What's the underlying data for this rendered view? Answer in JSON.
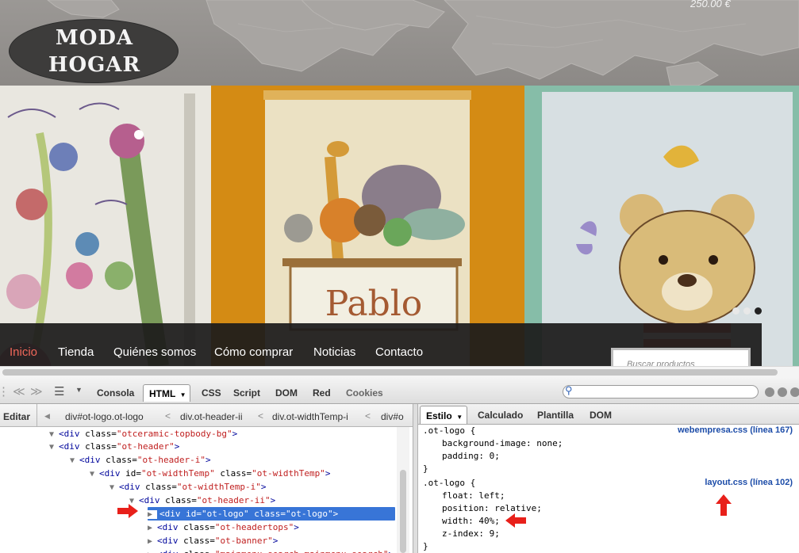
{
  "site": {
    "price": "250.00 €",
    "logo": {
      "line1": "MODA",
      "line2": "HOGAR"
    },
    "slider": {
      "panel2_name": "Pablo",
      "dots": 3,
      "active_dot": 3
    },
    "nav": {
      "items": [
        "Inicio",
        "Tienda",
        "Quiénes somos",
        "Cómo comprar",
        "Noticias",
        "Contacto"
      ],
      "active_index": 0
    },
    "search": {
      "placeholder": "Buscar productos"
    }
  },
  "firebug": {
    "toolbar": {
      "tabs": [
        "Consola",
        "HTML",
        "CSS",
        "Script",
        "DOM",
        "Red",
        "Cookies"
      ],
      "active_tab": "HTML",
      "search_value": ""
    },
    "breadcrumb": {
      "edit_label": "Editar",
      "items": [
        "div#ot-logo.ot-logo",
        "div.ot-header-ii",
        "div.ot-widthTemp-i",
        "div#o"
      ]
    },
    "tree": [
      {
        "tag": "div",
        "attrs": [
          [
            "class",
            "otceramic-topbody-bg"
          ]
        ],
        "twisty": "open"
      },
      {
        "tag": "div",
        "attrs": [
          [
            "class",
            "ot-header"
          ]
        ],
        "twisty": "open"
      },
      {
        "tag": "div",
        "attrs": [
          [
            "class",
            "ot-header-i"
          ]
        ],
        "twisty": "open"
      },
      {
        "tag": "div",
        "attrs": [
          [
            "id",
            "ot-widthTemp"
          ],
          [
            "class",
            "ot-widthTemp"
          ]
        ],
        "twisty": "open"
      },
      {
        "tag": "div",
        "attrs": [
          [
            "class",
            "ot-widthTemp-i"
          ]
        ],
        "twisty": "open"
      },
      {
        "tag": "div",
        "attrs": [
          [
            "class",
            "ot-header-ii"
          ]
        ],
        "twisty": "open"
      },
      {
        "tag": "div",
        "attrs": [
          [
            "id",
            "ot-logo"
          ],
          [
            "class",
            "ot-logo"
          ]
        ],
        "twisty": "closed",
        "selected": true
      },
      {
        "tag": "div",
        "attrs": [
          [
            "class",
            "ot-headertops"
          ]
        ],
        "twisty": "closed"
      },
      {
        "tag": "div",
        "attrs": [
          [
            "class",
            "ot-banner"
          ]
        ],
        "twisty": "closed"
      },
      {
        "tag": "div",
        "attrs": [
          [
            "class",
            "mainmenu-search mainmenu-search"
          ]
        ],
        "twisty": "closed"
      }
    ],
    "side_tabs": [
      "Estilo",
      "Calculado",
      "Plantilla",
      "DOM"
    ],
    "active_side_tab": "Estilo",
    "rules": [
      {
        "selector": ".ot-logo {",
        "source": "webempresa.css (línea 167)",
        "declarations": [
          "background-image: none;",
          "padding: 0;"
        ],
        "close": "}"
      },
      {
        "selector": ".ot-logo {",
        "source": "layout.css (línea 102)",
        "declarations": [
          "float: left;",
          "position: relative;",
          "width: 40%;",
          "z-index: 9;"
        ],
        "close": "}"
      }
    ],
    "colors": {
      "selection": "#3875d7",
      "attr_value": "#c02020",
      "tag": "#00069c",
      "source_link": "#1c4ca8",
      "annotation_arrow": "#e8201a"
    }
  }
}
